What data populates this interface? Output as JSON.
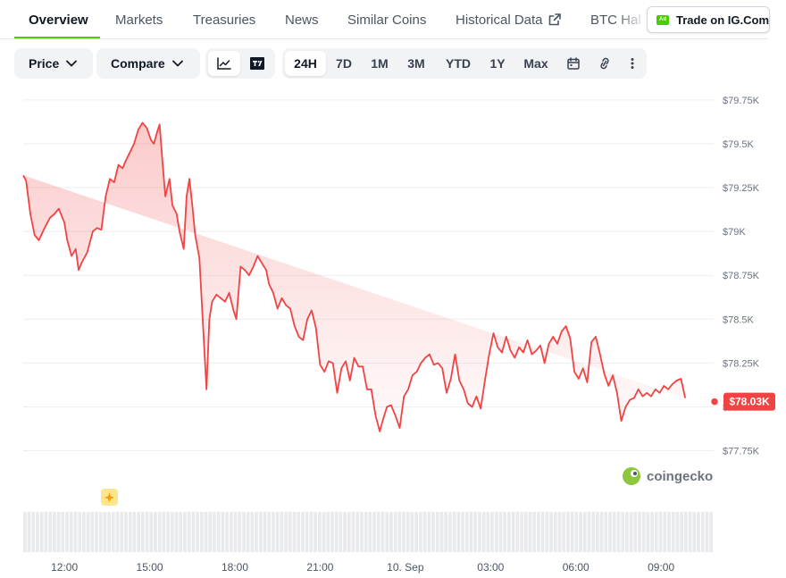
{
  "tabs": [
    {
      "label": "Overview",
      "active": true
    },
    {
      "label": "Markets"
    },
    {
      "label": "Treasuries"
    },
    {
      "label": "News"
    },
    {
      "label": "Similar Coins"
    },
    {
      "label": "Historical Data"
    },
    {
      "label": "BTC Hal"
    }
  ],
  "ad": {
    "badge": "Ad",
    "label": "Trade on IG.Com"
  },
  "toolbar": {
    "price_label": "Price",
    "compare_label": "Compare",
    "ranges": [
      "24H",
      "7D",
      "1M",
      "3M",
      "YTD",
      "1Y",
      "Max"
    ],
    "selected_range": "24H"
  },
  "colors": {
    "accent": "#4bcc00",
    "line": "#f04444",
    "volume": "#e8eaed"
  },
  "icons": [
    "chevron-down-icon",
    "line-chart-icon",
    "tradingview-icon",
    "calendar-icon",
    "link-icon",
    "more-vertical-icon",
    "external-link-icon",
    "sparkle-icon"
  ],
  "watermark": "coingecko",
  "chart_data": {
    "type": "area",
    "ylim": [
      77600,
      79790
    ],
    "y_ticks": [
      "$79.75K",
      "$79.5K",
      "$79.25K",
      "$79K",
      "$78.75K",
      "$78.5K",
      "$78.25K",
      "$78K",
      "$77.75K"
    ],
    "y_tick_values": [
      79750,
      79500,
      79250,
      79000,
      78750,
      78500,
      78250,
      78000,
      77750
    ],
    "x_ticks": [
      "12:00",
      "15:00",
      "18:00",
      "21:00",
      "10. Sep",
      "03:00",
      "06:00",
      "09:00"
    ],
    "x_tick_values": [
      1.5,
      4.5,
      7.5,
      10.5,
      13.5,
      16.5,
      19.5,
      22.5
    ],
    "xlim": [
      0.05,
      24.35
    ],
    "current_price": "$78.03K",
    "current_value": 78030,
    "x": [
      0.05,
      0.15,
      0.3,
      0.45,
      0.6,
      0.8,
      1.0,
      1.15,
      1.3,
      1.5,
      1.6,
      1.75,
      1.9,
      2.0,
      2.1,
      2.3,
      2.5,
      2.65,
      2.8,
      2.95,
      3.1,
      3.25,
      3.4,
      3.55,
      3.65,
      3.8,
      3.95,
      4.1,
      4.25,
      4.4,
      4.55,
      4.65,
      4.75,
      4.85,
      4.95,
      5.05,
      5.2,
      5.3,
      5.45,
      5.55,
      5.7,
      5.8,
      5.9,
      6.0,
      6.1,
      6.25,
      6.4,
      6.5,
      6.6,
      6.7,
      6.85,
      7.0,
      7.15,
      7.3,
      7.45,
      7.55,
      7.7,
      7.85,
      8.0,
      8.15,
      8.3,
      8.45,
      8.6,
      8.7,
      8.85,
      9.0,
      9.15,
      9.3,
      9.45,
      9.6,
      9.75,
      9.9,
      10.05,
      10.2,
      10.35,
      10.5,
      10.65,
      10.8,
      10.95,
      11.1,
      11.25,
      11.4,
      11.55,
      11.7,
      11.85,
      12.0,
      12.15,
      12.3,
      12.45,
      12.6,
      12.7,
      12.85,
      13.0,
      13.15,
      13.3,
      13.45,
      13.6,
      13.75,
      13.9,
      14.05,
      14.2,
      14.35,
      14.5,
      14.65,
      14.8,
      14.95,
      15.1,
      15.25,
      15.4,
      15.55,
      15.7,
      15.85,
      16.0,
      16.15,
      16.3,
      16.45,
      16.6,
      16.75,
      16.9,
      17.05,
      17.2,
      17.35,
      17.5,
      17.65,
      17.8,
      17.95,
      18.1,
      18.25,
      18.4,
      18.55,
      18.7,
      18.85,
      19.0,
      19.15,
      19.3,
      19.45,
      19.6,
      19.75,
      19.9,
      20.05,
      20.2,
      20.35,
      20.5,
      20.65,
      20.8,
      20.95,
      21.1,
      21.25,
      21.4,
      21.55,
      21.7,
      21.85,
      22.0,
      22.15,
      22.3,
      22.45,
      22.6,
      22.75,
      22.9,
      23.05,
      23.2,
      23.35,
      23.5,
      23.65,
      23.8,
      23.95,
      24.1,
      24.25
    ],
    "values": [
      79320,
      79290,
      79100,
      78980,
      78950,
      79020,
      79080,
      79100,
      79130,
      79050,
      78950,
      78860,
      78900,
      78780,
      78820,
      78880,
      79000,
      79020,
      79010,
      79200,
      79300,
      79280,
      79380,
      79360,
      79400,
      79450,
      79500,
      79580,
      79620,
      79590,
      79520,
      79500,
      79560,
      79610,
      79400,
      79200,
      79300,
      79150,
      79100,
      79000,
      78900,
      79200,
      79300,
      79150,
      78980,
      78850,
      78400,
      78100,
      78500,
      78600,
      78640,
      78620,
      78600,
      78650,
      78550,
      78500,
      78800,
      78780,
      78750,
      78800,
      78860,
      78820,
      78780,
      78700,
      78650,
      78560,
      78620,
      78580,
      78560,
      78460,
      78400,
      78380,
      78500,
      78550,
      78450,
      78240,
      78200,
      78260,
      78250,
      78080,
      78220,
      78260,
      78150,
      78280,
      78230,
      78230,
      78100,
      78100,
      77950,
      77860,
      77920,
      78000,
      78010,
      77950,
      77880,
      78060,
      78100,
      78180,
      78200,
      78250,
      78280,
      78300,
      78240,
      78250,
      78220,
      78080,
      78160,
      78300,
      78150,
      78100,
      78020,
      78000,
      78060,
      77990,
      78150,
      78300,
      78420,
      78340,
      78310,
      78400,
      78320,
      78280,
      78340,
      78310,
      78380,
      78300,
      78320,
      78350,
      78250,
      78360,
      78400,
      78360,
      78430,
      78460,
      78390,
      78200,
      78160,
      78220,
      78140,
      78370,
      78400,
      78300,
      78190,
      78120,
      78180,
      78080,
      77920,
      78000,
      78040,
      78050,
      78100,
      78060,
      78080,
      78060,
      78100,
      78080,
      78120,
      78100,
      78130,
      78150,
      78160,
      78050
    ],
    "volume": [
      0.72,
      0.72,
      0.72,
      0.72,
      0.72,
      0.72,
      0.72,
      0.72,
      0.72,
      0.72,
      0.72,
      0.72,
      0.72,
      0.72,
      0.72,
      0.72,
      0.72,
      0.72,
      0.72,
      0.72,
      0.72,
      0.72,
      0.72,
      0.72,
      0.72,
      0.72,
      0.72,
      0.72,
      0.72,
      0.72,
      0.72,
      0.72,
      0.72,
      0.72,
      0.72,
      0.72,
      0.72,
      0.72,
      0.72,
      0.72,
      0.72,
      0.72,
      0.72,
      0.72,
      0.72,
      0.72,
      0.72,
      0.72,
      0.72,
      0.72,
      0.72,
      0.72,
      0.72,
      0.72,
      0.72,
      0.72,
      0.72,
      0.72,
      0.72,
      0.72,
      0.72,
      0.72,
      0.72,
      0.72,
      0.72,
      0.72,
      0.72,
      0.72,
      0.72,
      0.72,
      0.72,
      0.72,
      0.72,
      0.72,
      0.72,
      0.72,
      0.72,
      0.72,
      0.72,
      0.72,
      0.72,
      0.72,
      0.72,
      0.72,
      0.72,
      0.72,
      0.72,
      0.72,
      0.72,
      0.72,
      0.72,
      0.72,
      0.72,
      0.72,
      0.72,
      0.72,
      0.72,
      0.72,
      0.72,
      0.72,
      0.72,
      0.72,
      0.72,
      0.72,
      0.72,
      0.72,
      0.72,
      0.72,
      0.72,
      0.72,
      0.72,
      0.72,
      0.72,
      0.72,
      0.72,
      0.72,
      0.72,
      0.72,
      0.72,
      0.72,
      0.72,
      0.72,
      0.72,
      0.72,
      0.72,
      0.72,
      0.72,
      0.72,
      0.72,
      0.72,
      0.72,
      0.72,
      0.72,
      0.72,
      0.72,
      0.72,
      0.72,
      0.72,
      0.72,
      0.72,
      0.72,
      0.72,
      0.72,
      0.72,
      0.72,
      0.72,
      0.72,
      0.72,
      0.72,
      0.72,
      0.72,
      0.72,
      0.72,
      0.72,
      0.72,
      0.72,
      0.72,
      0.72,
      0.72,
      0.72,
      0.72,
      0.72,
      0.72,
      0.72
    ]
  }
}
